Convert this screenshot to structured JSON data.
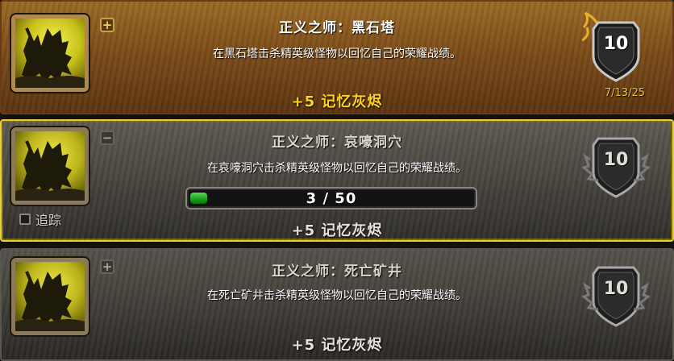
{
  "achievements": [
    {
      "state": "completed",
      "toggle_icon": "plus",
      "title": "正义之师：黑石塔",
      "description": "在黑石塔击杀精英级怪物以回忆自己的荣耀战绩。",
      "reward": "+5 记忆灰烬",
      "points": "10",
      "date": "7/13/25",
      "colors": {
        "title": "#ffffff",
        "reward": "#ffd21c",
        "border": "#6a3a1a"
      }
    },
    {
      "state": "in-progress",
      "toggle_icon": "minus",
      "title": "正义之师：哀嚎洞穴",
      "description": "在哀嚎洞穴击杀精英级怪物以回忆自己的荣耀战绩。",
      "reward": "+5 记忆灰烬",
      "points": "10",
      "progress": {
        "current": 3,
        "total": 50,
        "text": "3 / 50"
      },
      "track_label": "追踪",
      "track_checked": false,
      "colors": {
        "border": "#e8d233",
        "fill": "#18a018"
      }
    },
    {
      "state": "incomplete",
      "toggle_icon": "plus",
      "title": "正义之师：死亡矿井",
      "description": "在死亡矿井击杀精英级怪物以回忆自己的荣耀战绩。",
      "reward": "+5 记忆灰烬",
      "points": "10"
    }
  ],
  "icons": {
    "achievement_icon": "warrior-silhouette-icon",
    "points_badge": "shield-badge-icon"
  }
}
